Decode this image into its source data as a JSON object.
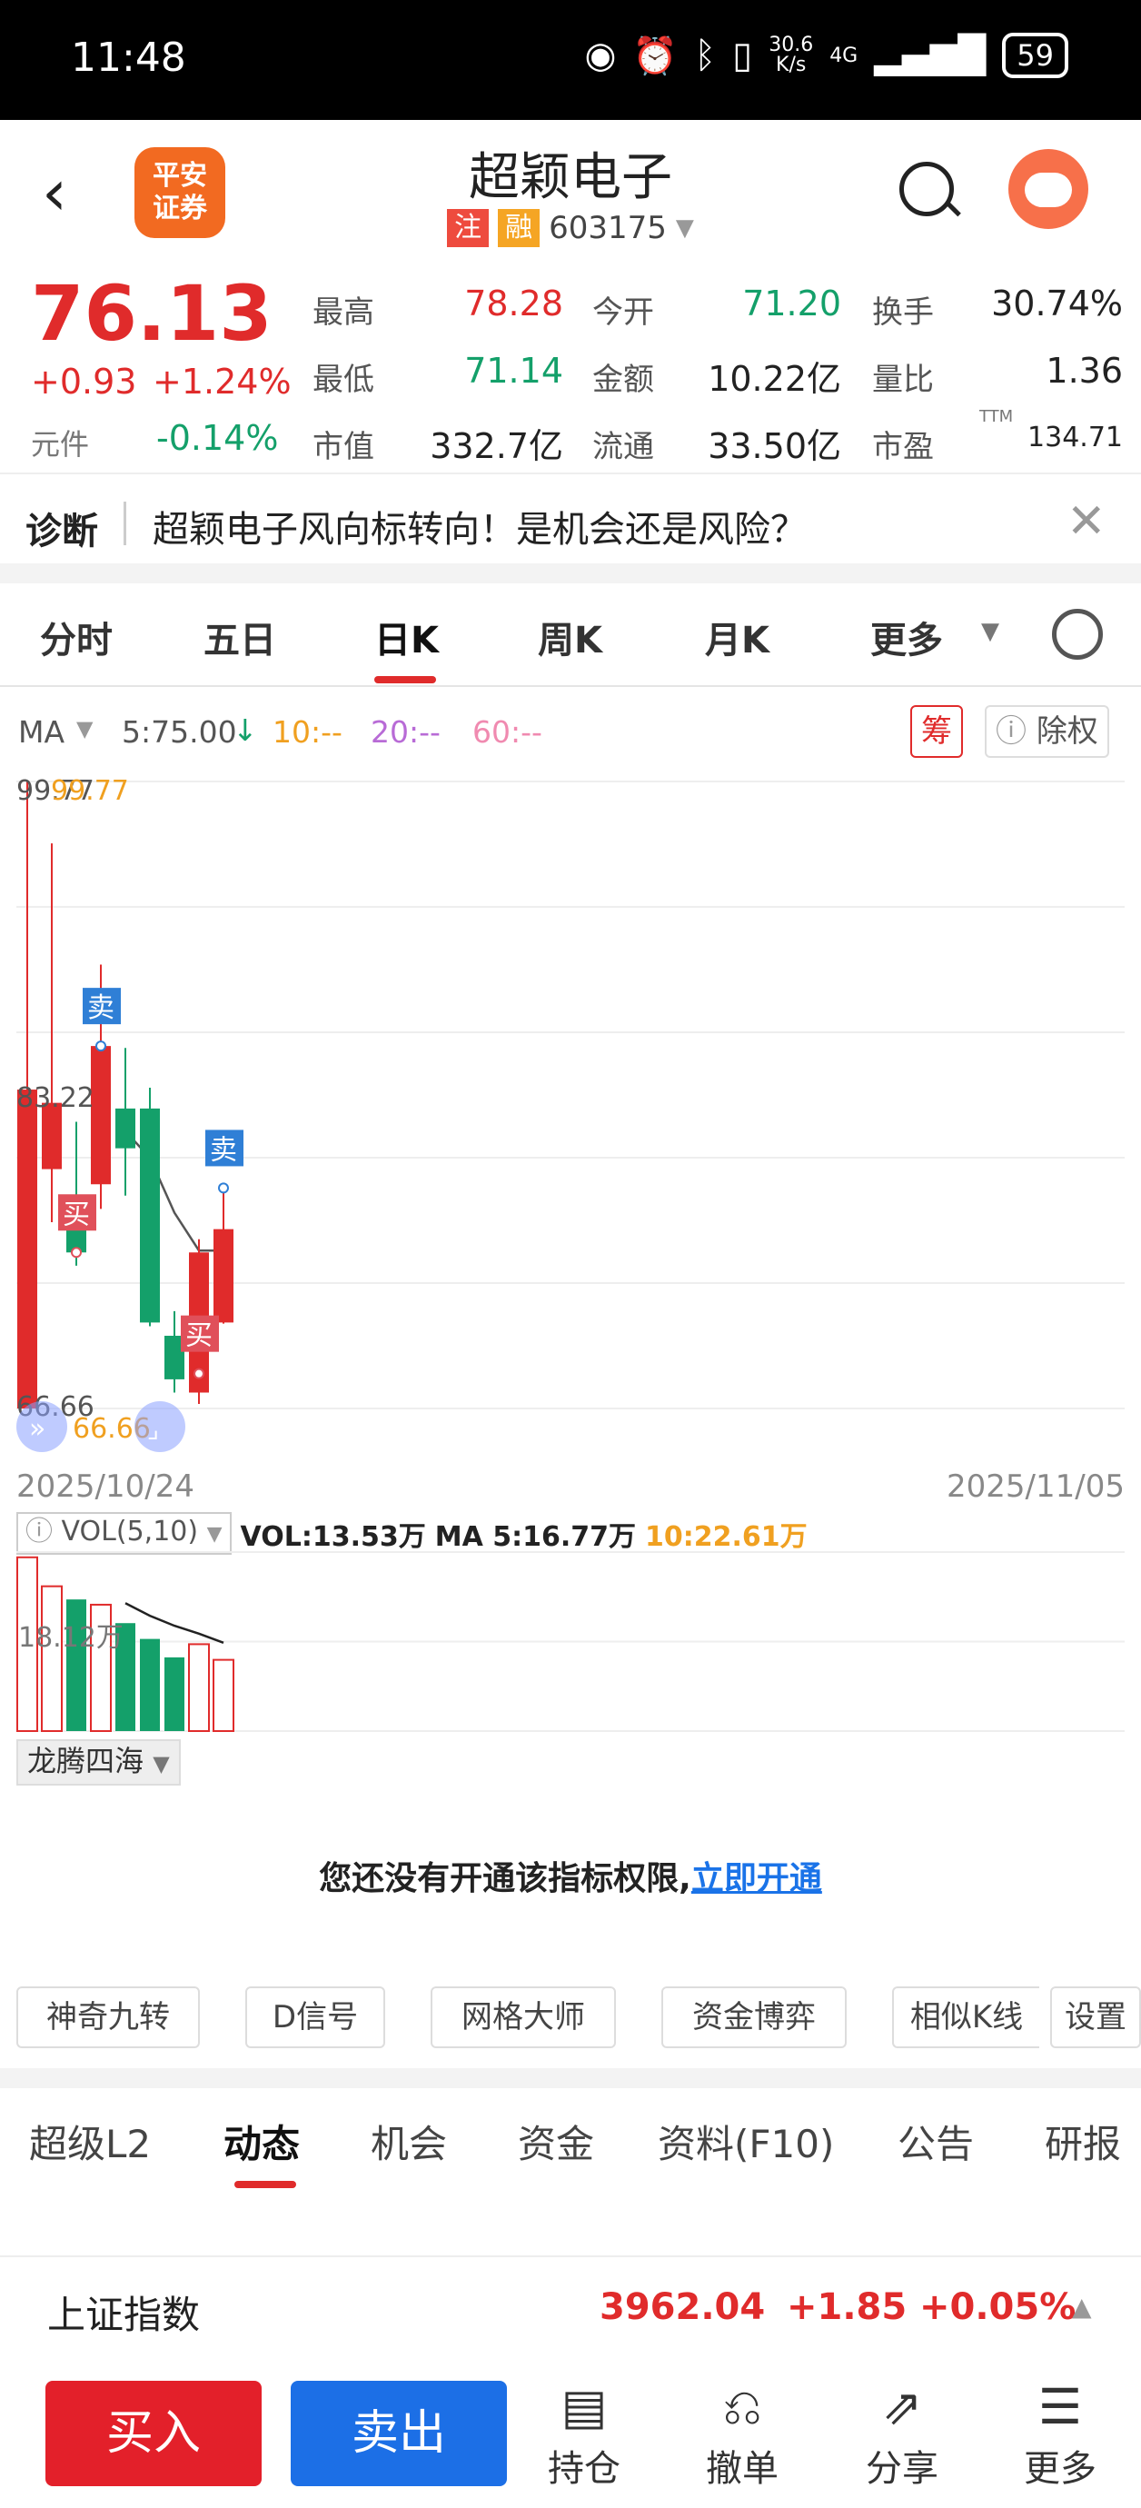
{
  "status_bar": {
    "time": "11:48",
    "net_speed_top": "30.6",
    "net_speed_unit": "K/s",
    "network": "4G",
    "battery": "59"
  },
  "header": {
    "back_icon": "chevron-left-icon",
    "broker_logo_line1": "平安",
    "broker_logo_line2": "证券",
    "stock_name": "超颖电子",
    "tag_zhu": "注",
    "tag_rong": "融",
    "stock_code": "603175"
  },
  "quote": {
    "price": "76.13",
    "change": "+0.93",
    "change_pct": "+1.24%",
    "unit_label": "元件",
    "unit_change": "-0.14%",
    "high_label": "最高",
    "high": "78.28",
    "open_label": "今开",
    "open": "71.20",
    "turnover_label": "换手",
    "turnover": "30.74%",
    "low_label": "最低",
    "low": "71.14",
    "amount_label": "金额",
    "amount": "10.22亿",
    "vol_ratio_label": "量比",
    "vol_ratio": "1.36",
    "mktcap_label": "市值",
    "mktcap": "332.7亿",
    "float_label": "流通",
    "float": "33.50亿",
    "pe_label": "市盈",
    "pe_sup": "TTM",
    "pe": "134.71"
  },
  "diagnosis": {
    "title": "诊断",
    "text": "超颖电子风向标转向！是机会还是风险？"
  },
  "ktabs": [
    "分时",
    "五日",
    "日K",
    "周K",
    "月K",
    "更多"
  ],
  "ma": {
    "label": "MA",
    "ma5": "5:75.00",
    "ma10": "10:--",
    "ma20": "20:--",
    "ma60": "60:--",
    "chou": "筹",
    "chuquan": "除权"
  },
  "colors": {
    "up": "#e02b2b",
    "down": "#14a06a",
    "ma5": "#555555",
    "ma10": "#f0a020",
    "ma20": "#b86bd6",
    "ma60": "#f08ab0"
  },
  "chart_labels": {
    "high": "99.77",
    "high_orange": "99.77",
    "mid": "83.22",
    "low": "66.66",
    "low_orange": "66.66",
    "buy": "买",
    "sell": "卖",
    "date_start": "2025/10/24",
    "date_end": "2025/11/05"
  },
  "volume": {
    "indicator": "VOL(5,10)",
    "vol": "VOL:13.53万",
    "ma5": "MA 5:16.77万",
    "ma10": "10:22.61万",
    "axis_mid": "18.12万",
    "sub_indicator": "龙腾四海"
  },
  "notice": {
    "text": "您还没有开通该指标权限,",
    "link": "立即开通"
  },
  "indicators": [
    "神奇九转",
    "D信号",
    "网格大师",
    "资金博弈",
    "相似K线",
    "设置"
  ],
  "bottom_tabs": [
    "超级L2",
    "动态",
    "机会",
    "资金",
    "资料(F10)",
    "公告",
    "研报"
  ],
  "index_bar": {
    "name": "上证指数",
    "value": "3962.04",
    "change": "+1.85",
    "pct": "+0.05%"
  },
  "actions": {
    "buy": "买入",
    "sell": "卖出",
    "holdings": "持仓",
    "cancel": "撤单",
    "share": "分享",
    "more": "更多"
  },
  "chart_data": {
    "type": "candlestick",
    "x": [
      "2025/10/24",
      "",
      "",
      "",
      "",
      "",
      "",
      "",
      "2025/11/05"
    ],
    "ylim": [
      66.66,
      99.77
    ],
    "candles": [
      {
        "o": 66.66,
        "c": 83.5,
        "h": 99.77,
        "l": 66.66
      },
      {
        "o": 79.3,
        "c": 82.8,
        "h": 96.5,
        "l": 76.5
      },
      {
        "o": 77.8,
        "c": 74.9,
        "h": 81.8,
        "l": 74.2
      },
      {
        "o": 78.5,
        "c": 85.8,
        "h": 90.1,
        "l": 77.2
      },
      {
        "o": 82.5,
        "c": 80.4,
        "h": 85.7,
        "l": 77.9
      },
      {
        "o": 82.5,
        "c": 71.2,
        "h": 83.6,
        "l": 71.0
      },
      {
        "o": 70.5,
        "c": 68.2,
        "h": 71.8,
        "l": 67.5
      },
      {
        "o": 67.5,
        "c": 74.9,
        "h": 75.6,
        "l": 66.9
      },
      {
        "o": 71.2,
        "c": 76.13,
        "h": 78.28,
        "l": 71.14
      }
    ],
    "ma5": [
      null,
      null,
      null,
      null,
      81.3,
      79.9,
      77.0,
      75.0,
      75.0
    ],
    "signals": [
      {
        "index": 2,
        "type": "买",
        "price": 74.9
      },
      {
        "index": 3,
        "type": "卖",
        "price": 85.8
      },
      {
        "index": 7,
        "type": "买",
        "price": 68.5
      },
      {
        "index": 8,
        "type": "卖",
        "price": 78.3
      }
    ],
    "volume": [
      33.0,
      27.5,
      25.0,
      24.0,
      20.5,
      17.5,
      14.0,
      16.5,
      13.53
    ],
    "volume_ma5": [
      null,
      null,
      null,
      null,
      24.3,
      21.9,
      20.0,
      18.5,
      16.77
    ],
    "volume_ylim": [
      0,
      34
    ],
    "volume_unit": "万"
  }
}
